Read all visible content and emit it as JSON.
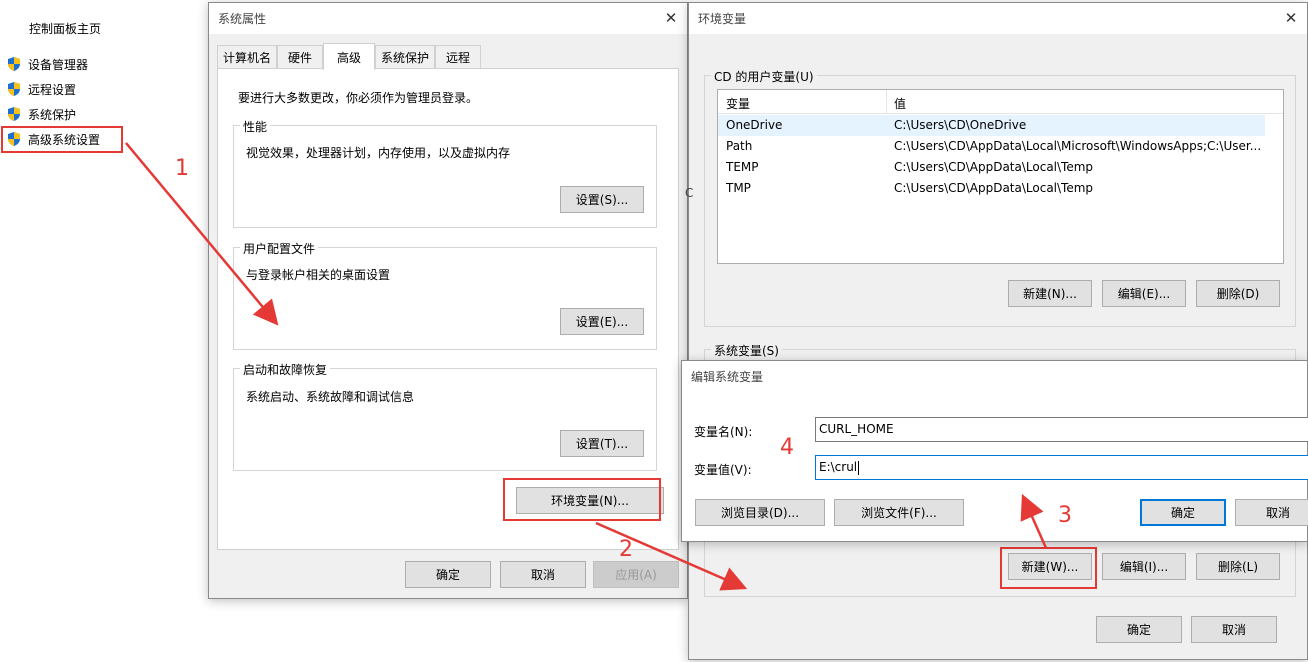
{
  "control_panel": {
    "home": "控制面板主页",
    "items": [
      {
        "label": "设备管理器"
      },
      {
        "label": "远程设置"
      },
      {
        "label": "系统保护"
      },
      {
        "label": "高级系统设置"
      }
    ]
  },
  "system_properties": {
    "title": "系统属性",
    "tabs": [
      "计算机名",
      "硬件",
      "高级",
      "系统保护",
      "远程"
    ],
    "admin_note": "要进行大多数更改，你必须作为管理员登录。",
    "performance": {
      "title": "性能",
      "desc": "视觉效果，处理器计划，内存使用，以及虚拟内存",
      "button": "设置(S)..."
    },
    "user_profiles": {
      "title": "用户配置文件",
      "desc": "与登录帐户相关的桌面设置",
      "button": "设置(E)..."
    },
    "startup_recovery": {
      "title": "启动和故障恢复",
      "desc": "系统启动、系统故障和调试信息",
      "button": "设置(T)..."
    },
    "env_button": "环境变量(N)...",
    "ok": "确定",
    "cancel": "取消",
    "apply": "应用(A)"
  },
  "env_vars": {
    "title": "环境变量",
    "user_group_title": "CD 的用户变量(U)",
    "columns": [
      "变量",
      "值"
    ],
    "user_vars": [
      {
        "name": "OneDrive",
        "value": "C:\\Users\\CD\\OneDrive"
      },
      {
        "name": "Path",
        "value": "C:\\Users\\CD\\AppData\\Local\\Microsoft\\WindowsApps;C:\\User..."
      },
      {
        "name": "TEMP",
        "value": "C:\\Users\\CD\\AppData\\Local\\Temp"
      },
      {
        "name": "TMP",
        "value": "C:\\Users\\CD\\AppData\\Local\\Temp"
      }
    ],
    "user_new": "新建(N)...",
    "user_edit": "编辑(E)...",
    "user_delete": "删除(D)",
    "system_group_title": "系统变量(S)",
    "sys_new": "新建(W)...",
    "sys_edit": "编辑(I)...",
    "sys_delete": "删除(L)",
    "ok": "确定",
    "cancel": "取消",
    "side_char": "C"
  },
  "edit_var": {
    "title": "编辑系统变量",
    "name_label": "变量名(N):",
    "name_value": "CURL_HOME",
    "value_label": "变量值(V):",
    "value_value": "E:\\crul",
    "browse_dir": "浏览目录(D)...",
    "browse_file": "浏览文件(F)...",
    "ok": "确定",
    "cancel": "取消"
  },
  "annotations": {
    "step1": "1",
    "step2": "2",
    "step3": "3",
    "step4": "4"
  },
  "colors": {
    "annotation": "#e53935",
    "accent": "#0078d7",
    "selection": "#e5f3ff"
  }
}
